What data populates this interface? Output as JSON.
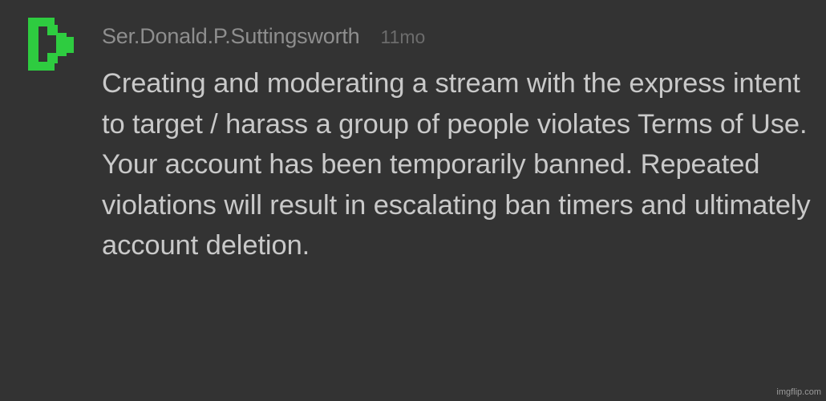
{
  "comment": {
    "avatar_icon": "pixel-letter-d-icon",
    "avatar_color": "#2ecc40",
    "username": "Ser.Donald.P.Suttingsworth",
    "timestamp": "11mo",
    "text": "Creating and moderating a stream with the express intent to target / harass a group of people violates Terms of Use. Your account has been temporarily banned. Repeated violations will result in escalating ban timers and ultimately account deletion."
  },
  "watermark": "imgflip.com",
  "colors": {
    "background": "#333333",
    "username": "#8e8e8e",
    "timestamp": "#6c6c6c",
    "body_text": "#c9c9c9"
  }
}
